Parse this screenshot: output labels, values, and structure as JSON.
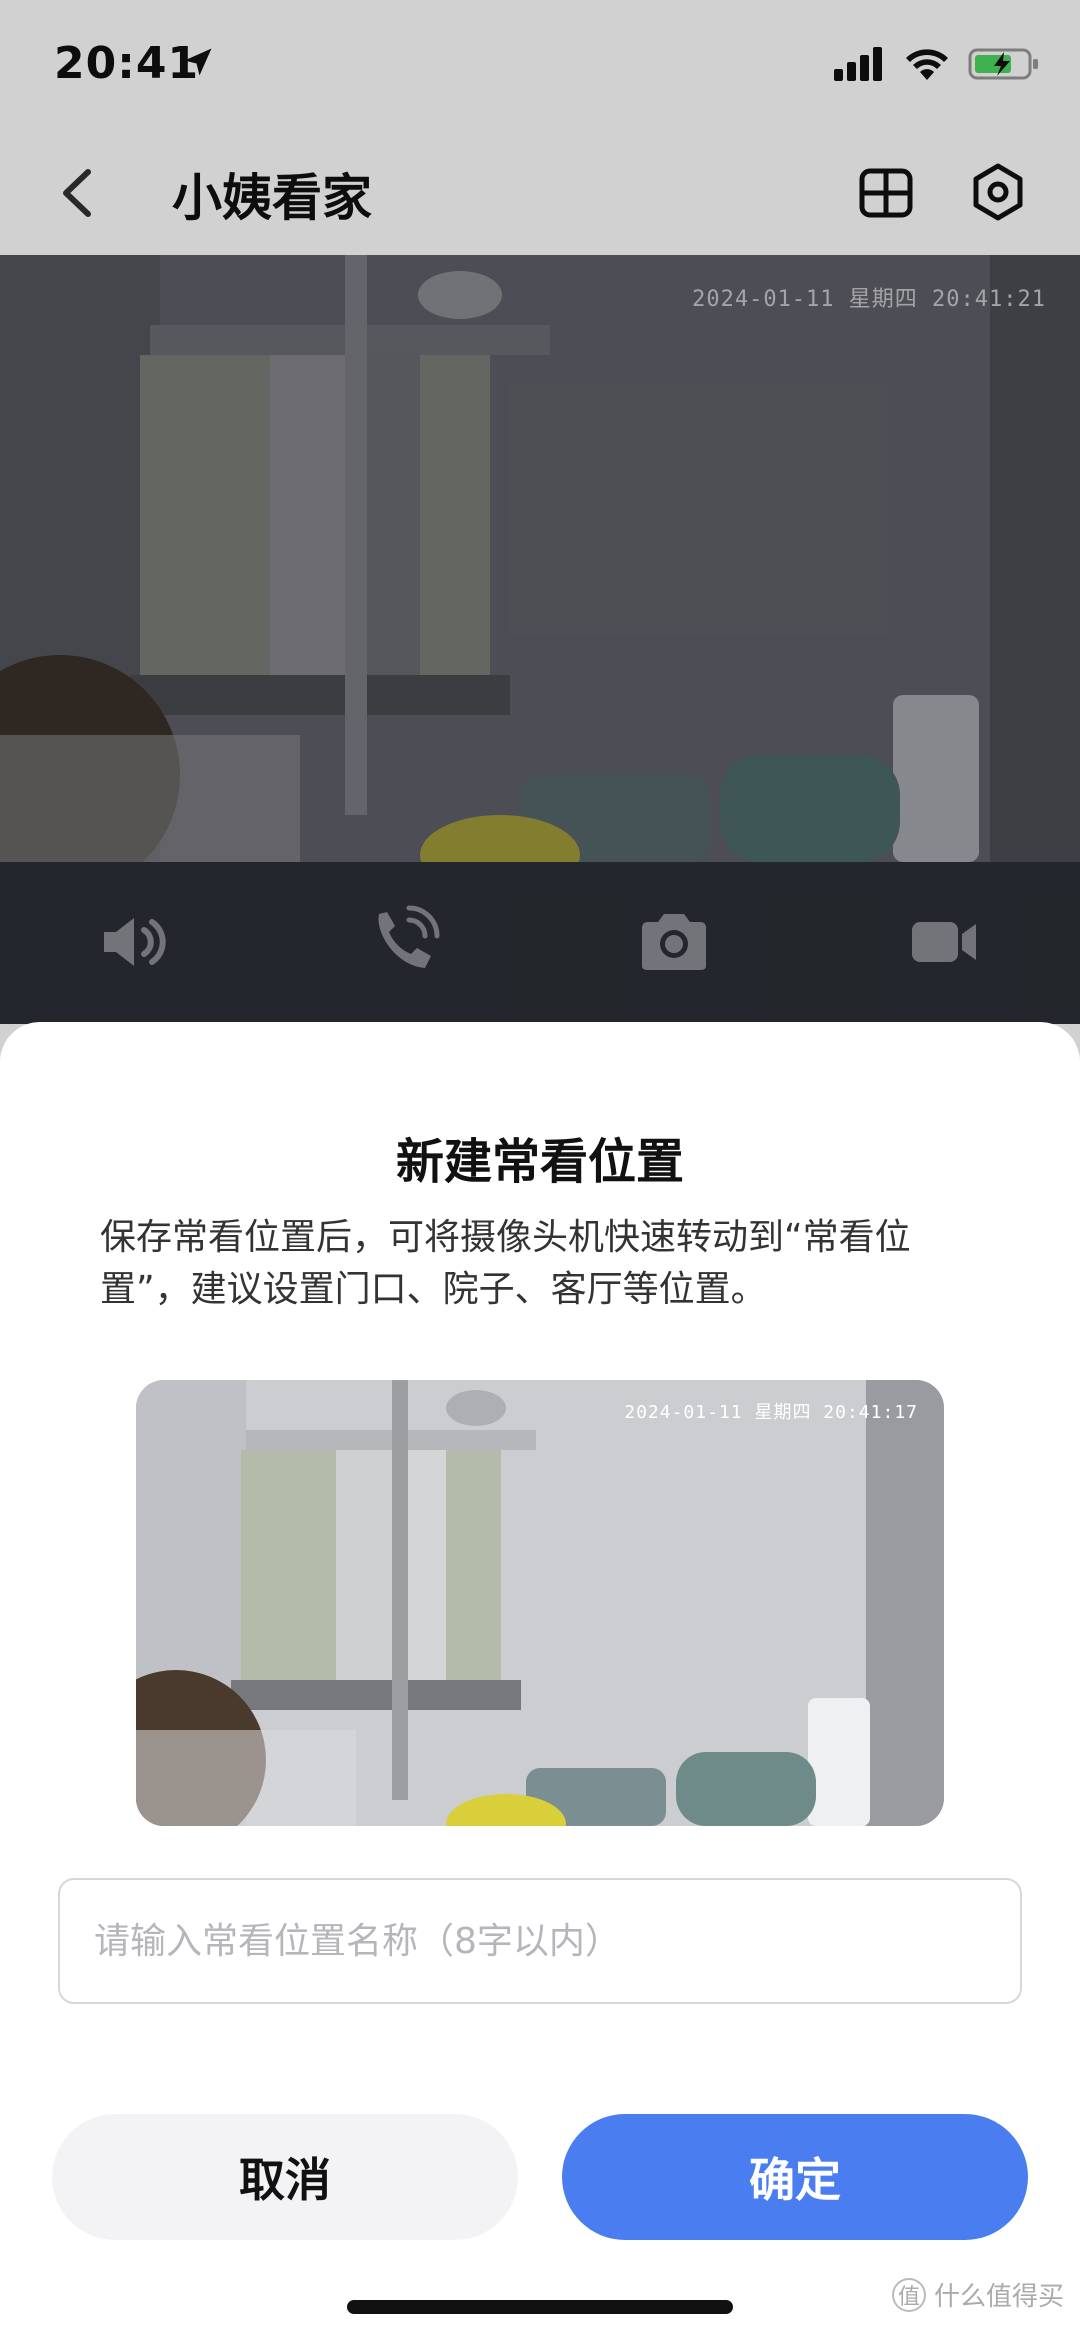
{
  "status_bar": {
    "time": "20:41"
  },
  "nav": {
    "title": "小姨看家"
  },
  "camera": {
    "timestamp": "2024-01-11 星期四 20:41:21"
  },
  "controls": [
    {
      "icon": "speaker-icon"
    },
    {
      "icon": "call-icon"
    },
    {
      "icon": "camera-snapshot-icon"
    },
    {
      "icon": "video-record-icon"
    }
  ],
  "sheet": {
    "title": "新建常看位置",
    "description": "保存常看位置后，可将摄像头机快速转动到“常看位置”，建议设置门口、院子、客厅等位置。",
    "preview_timestamp": "2024-01-11 星期四 20:41:17",
    "input_placeholder": "请输入常看位置名称（8字以内）",
    "cancel_label": "取消",
    "confirm_label": "确定"
  },
  "watermark": {
    "badge": "值",
    "text": "什么值得买"
  },
  "colors": {
    "accent": "#4a7ef0",
    "control_bar": "#2b2f36"
  }
}
